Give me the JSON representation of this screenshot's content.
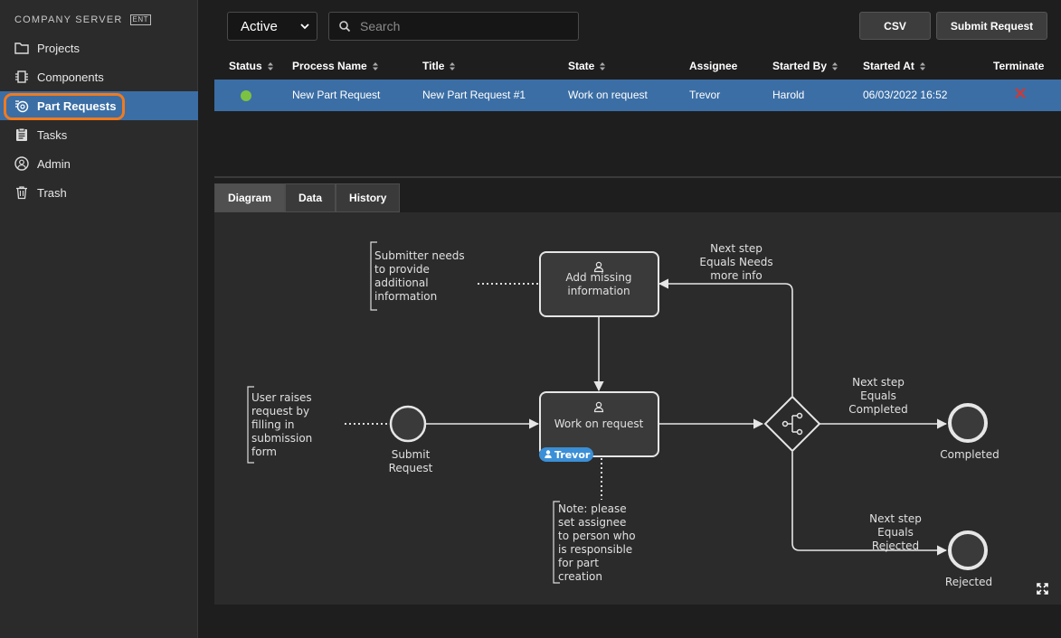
{
  "sidebar": {
    "brand": "COMPANY SERVER",
    "badge": "ENT",
    "items": [
      {
        "label": "Projects",
        "icon": "folder-icon"
      },
      {
        "label": "Components",
        "icon": "component-icon"
      },
      {
        "label": "Part Requests",
        "icon": "part-request-icon",
        "active": true
      },
      {
        "label": "Tasks",
        "icon": "clipboard-icon"
      },
      {
        "label": "Admin",
        "icon": "user-circle-icon"
      },
      {
        "label": "Trash",
        "icon": "trash-icon"
      }
    ]
  },
  "toolbar": {
    "filter_value": "Active",
    "search_placeholder": "Search",
    "csv_label": "CSV",
    "submit_label": "Submit Request"
  },
  "table": {
    "columns": [
      "Status",
      "Process Name",
      "Title",
      "State",
      "Assignee",
      "Started By",
      "Started At",
      "Terminate"
    ],
    "rows": [
      {
        "status": "active",
        "process_name": "New Part Request",
        "title": "New Part Request #1",
        "state": "Work on request",
        "assignee": "Trevor",
        "started_by": "Harold",
        "started_at": "06/03/2022 16:52"
      }
    ]
  },
  "tabs": [
    "Diagram",
    "Data",
    "History"
  ],
  "diagram": {
    "start_event": [
      "Submit",
      "Request"
    ],
    "task_work": "Work on request",
    "task_missing": [
      "Add missing",
      "information"
    ],
    "assignee_tag": "Trevor",
    "end_completed": "Completed",
    "end_rejected": "Rejected",
    "note_user": [
      "User raises",
      "request by",
      "filling in",
      "submission",
      "form"
    ],
    "note_submitter": [
      "Submitter needs",
      "to provide",
      "additional",
      "information"
    ],
    "note_assignee": [
      "Note: please",
      "set assignee",
      "to person who",
      "is responsible",
      "for part",
      "creation"
    ],
    "edge_needs_info": [
      "Next step",
      "Equals Needs",
      "more info"
    ],
    "edge_completed": [
      "Next step",
      "Equals",
      "Completed"
    ],
    "edge_rejected": [
      "Next step",
      "Equals",
      "Rejected"
    ]
  },
  "colors": {
    "accent": "#3b6ea5",
    "highlight": "#f07a1e",
    "status_ok": "#7cc242",
    "terminate": "#d9352f"
  }
}
